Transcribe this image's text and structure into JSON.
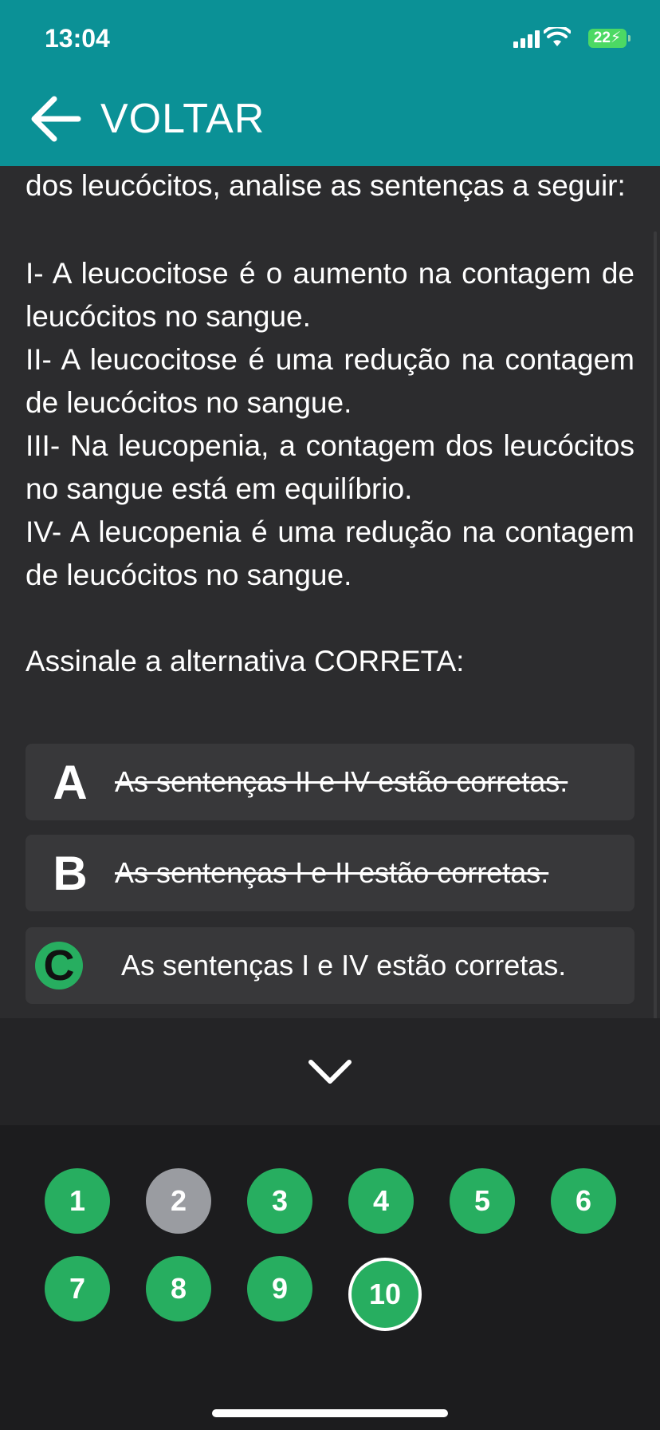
{
  "status_bar": {
    "time": "13:04",
    "battery": "22"
  },
  "nav": {
    "back_label": "VOLTAR"
  },
  "question": {
    "intro": "dos leucócitos, analise as sentenças a seguir:",
    "statements": [
      "I- A leucocitose é o aumento na contagem de leucócitos no sangue.",
      "II- A leucocitose é uma redução na contagem de leucócitos no sangue.",
      "III- Na leucopenia, a contagem dos leucócitos no sangue está em equilíbrio.",
      "IV- A leucopenia é uma redução na contagem de leucócitos no sangue."
    ],
    "prompt": "Assinale a alternativa CORRETA:"
  },
  "options": [
    {
      "letter": "A",
      "text": "As sentenças II e IV estão corretas.",
      "state": "eliminated"
    },
    {
      "letter": "B",
      "text": "As sentenças I e II estão corretas.",
      "state": "eliminated"
    },
    {
      "letter": "C",
      "text": "As sentenças I e IV estão corretas.",
      "state": "selected"
    }
  ],
  "navigator": {
    "collapse_icon": "chevron-down-icon",
    "questions": [
      "1",
      "2",
      "3",
      "4",
      "5",
      "6",
      "7",
      "8",
      "9",
      "10"
    ],
    "unanswered": [
      "2"
    ],
    "current": "10"
  },
  "colors": {
    "header": "#0b9196",
    "answered": "#27ae60",
    "unanswered": "#9a9ca1",
    "background": "#2c2c2e"
  }
}
